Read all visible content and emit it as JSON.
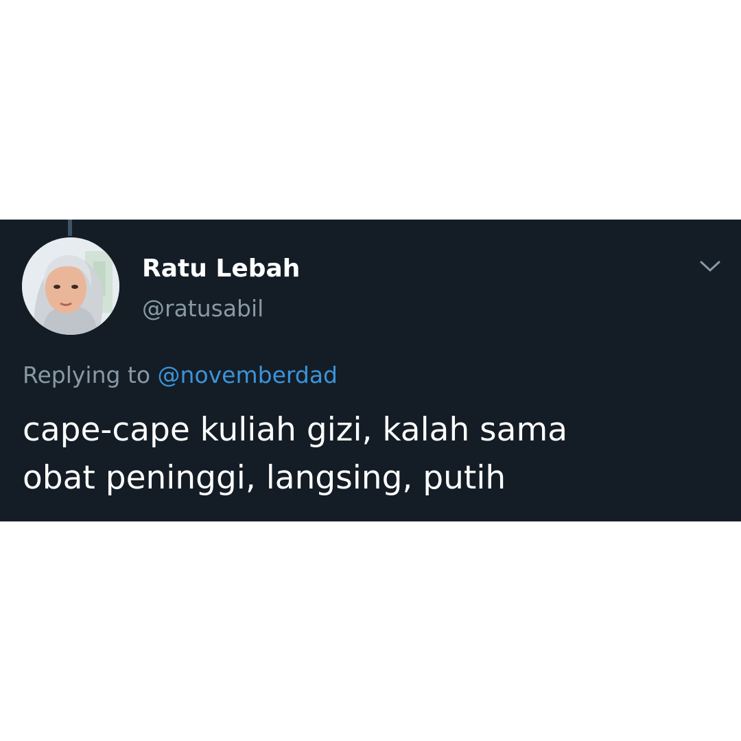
{
  "tweet": {
    "display_name": "Ratu Lebah",
    "handle": "@ratusabil",
    "replying_prefix": "Replying to",
    "replying_to": "@novemberdad",
    "text_lines": [
      "cape-cape kuliah gizi, kalah sama",
      "obat peninggi, langsing, putih"
    ],
    "icons": {
      "avatar": "profile-photo",
      "menu": "chevron-down-icon"
    },
    "colors": {
      "card_background": "#141d26",
      "name": "#ffffff",
      "secondary_text": "#8899a6",
      "mention": "#3b94d9",
      "body_text": "#ffffff"
    }
  }
}
